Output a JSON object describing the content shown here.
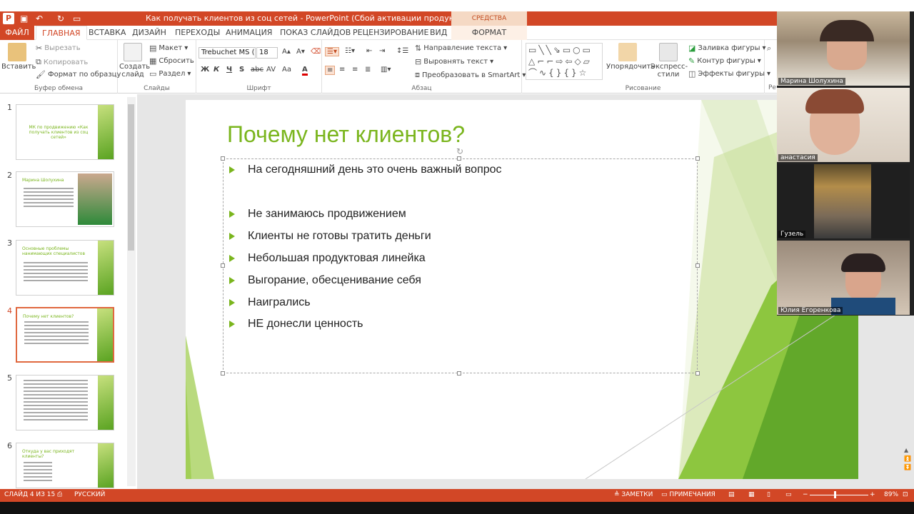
{
  "window": {
    "title": "Как получать клиентов из соц сетей - PowerPoint (Сбой активации продукта)",
    "context_tab_group": "СРЕДСТВА РИСОВАНИЯ"
  },
  "tabs": [
    {
      "label": "ФАЙЛ"
    },
    {
      "label": "ГЛАВНАЯ"
    },
    {
      "label": "ВСТАВКА"
    },
    {
      "label": "ДИЗАЙН"
    },
    {
      "label": "ПЕРЕХОДЫ"
    },
    {
      "label": "АНИМАЦИЯ"
    },
    {
      "label": "ПОКАЗ СЛАЙДОВ"
    },
    {
      "label": "РЕЦЕНЗИРОВАНИЕ"
    },
    {
      "label": "ВИД"
    },
    {
      "label": "ФОРМАТ"
    }
  ],
  "ribbon": {
    "clipboard": {
      "paste": "Вставить",
      "cut": "Вырезать",
      "copy": "Копировать",
      "format_painter": "Формат по образцу",
      "label": "Буфер обмена"
    },
    "slides": {
      "new_slide_1": "Создать",
      "new_slide_2": "слайд",
      "layout": "Макет",
      "reset": "Сбросить",
      "section": "Раздел",
      "label": "Слайды"
    },
    "font": {
      "font_name": "Trebuchet MS (",
      "font_size": "18",
      "label": "Шрифт",
      "bold": "Ж",
      "italic": "К",
      "underline": "Ч",
      "shadow": "S",
      "strike": "abc",
      "spacing": "AV",
      "case": "Aa",
      "color": "A"
    },
    "paragraph": {
      "text_direction": "Направление текста",
      "align_text": "Выровнять текст",
      "smartart": "Преобразовать в SmartArt",
      "label": "Абзац"
    },
    "drawing": {
      "arrange": "Упорядочить",
      "quick_styles_1": "Экспресс-",
      "quick_styles_2": "стили",
      "fill": "Заливка фигуры",
      "outline": "Контур фигуры",
      "effects": "Эффекты фигуры",
      "label": "Рисование",
      "cut_label": "Ре"
    }
  },
  "thumbnails": [
    {
      "num": "1",
      "text": "МК по продвижению «Как получать клиентов из соц сетей»"
    },
    {
      "num": "2",
      "text": "Марина Шолухина"
    },
    {
      "num": "3",
      "text": "Основные проблемы нанимающих специалистов"
    },
    {
      "num": "4",
      "text": "Почему нет клиентов?"
    },
    {
      "num": "5",
      "text": ""
    },
    {
      "num": "6",
      "text": "Откуда у вас приходят клиенты?"
    }
  ],
  "slide": {
    "title": "Почему нет клиентов?",
    "bullets": [
      "На сегодняшний день это очень важный вопрос",
      "Не занимаюсь продвижением",
      "Клиенты не готовы тратить деньги",
      "Небольшая продуктовая линейка",
      "Выгорание, обесценивание себя",
      "Наигрались",
      "НЕ донесли ценность"
    ]
  },
  "participants": [
    {
      "name": "Марина Шолухина"
    },
    {
      "name": "анастасия"
    },
    {
      "name": "Гузель"
    },
    {
      "name": "Юлия Егоренкова"
    }
  ],
  "status": {
    "slide_info": "СЛАЙД 4 ИЗ 15",
    "language": "РУССКИЙ",
    "notes": "ЗАМЕТКИ",
    "comments": "ПРИМЕЧАНИЯ",
    "zoom": "89%"
  },
  "colors": {
    "accent": "#d24726",
    "slide_green": "#7ab51d"
  }
}
